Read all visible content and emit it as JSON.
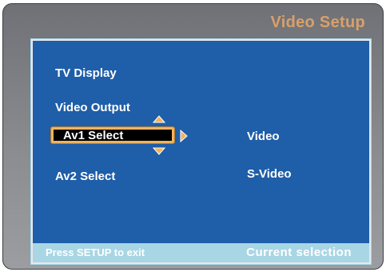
{
  "header": {
    "title": "Video Setup"
  },
  "menu": {
    "items": [
      {
        "label": "TV Display"
      },
      {
        "label": "Video Output"
      },
      {
        "label": "Av1 Select"
      },
      {
        "label": "Av2 Select"
      }
    ],
    "selected_index": 2
  },
  "values": {
    "av1": "Video",
    "av2": "S-Video"
  },
  "footer": {
    "hint": "Press SETUP to exit",
    "status": "Current selection"
  },
  "colors": {
    "panel_background": "#1f5ea8",
    "highlight_border": "#f0b45c",
    "title_color": "#d9a06a",
    "footer_background": "#a8d6e5"
  },
  "icons": {
    "up": "triangle-up-icon",
    "down": "triangle-down-icon",
    "right": "triangle-right-icon"
  }
}
